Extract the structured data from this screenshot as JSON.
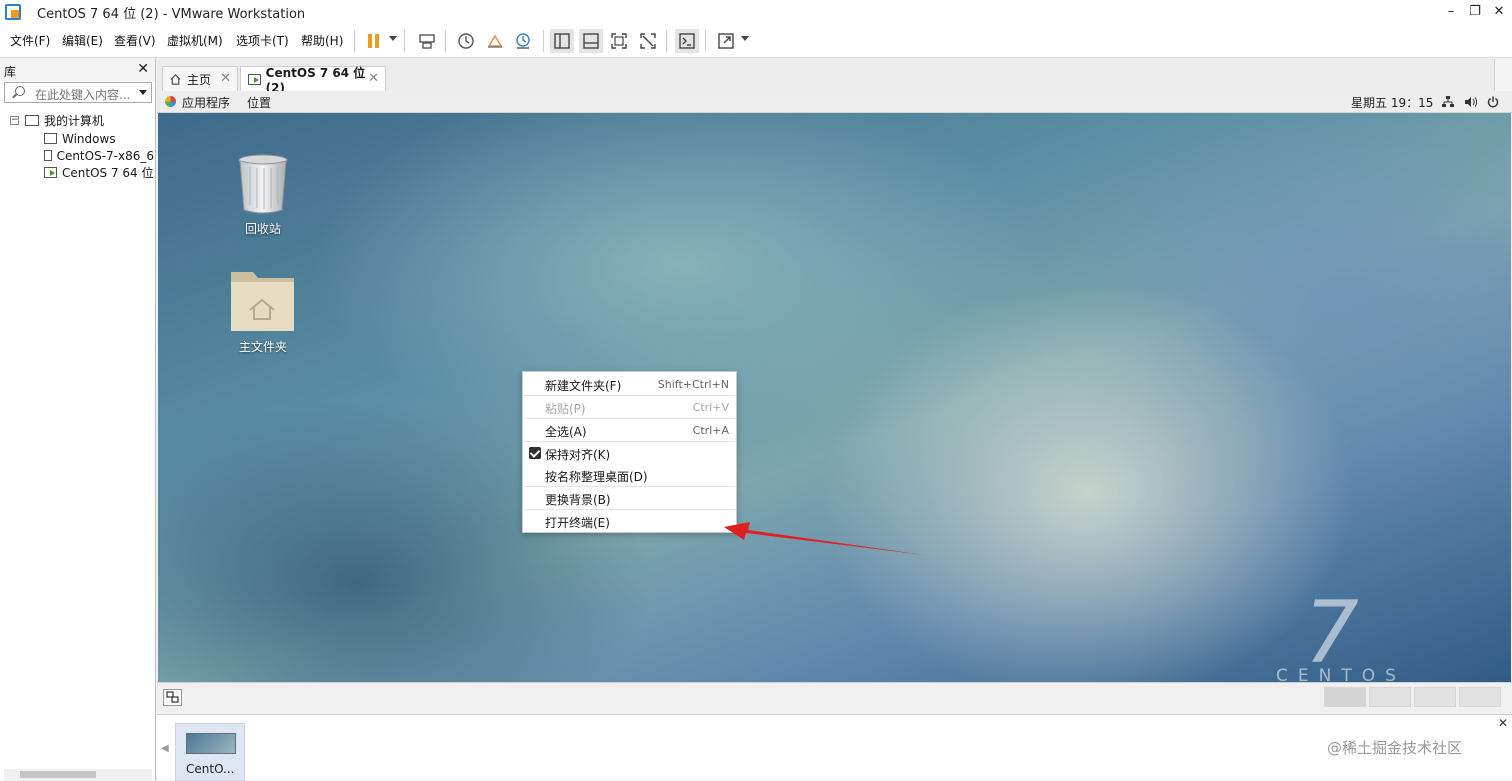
{
  "window": {
    "title": "CentOS 7 64 位 (2) - VMware Workstation",
    "min": "–",
    "max": "❐",
    "close": "✕"
  },
  "menu": [
    "文件(F)",
    "编辑(E)",
    "查看(V)",
    "虚拟机(M)",
    "选项卡(T)",
    "帮助(H)"
  ],
  "library": {
    "title": "库",
    "close": "✕",
    "search_placeholder": "在此处键入内容...",
    "tree": {
      "root": "我的计算机",
      "items": [
        "Windows",
        "CentOS-7-x86_6",
        "CentOS 7 64 位"
      ]
    }
  },
  "tabs": [
    {
      "label": "主页",
      "active": false
    },
    {
      "label": "CentOS 7 64 位 (2)",
      "active": true
    }
  ],
  "guest_panel": {
    "apps": "应用程序",
    "places": "位置",
    "clock": "星期五 19：15"
  },
  "desktop": {
    "icons": [
      {
        "label": "回收站",
        "icon": "trash-icon"
      },
      {
        "label": "主文件夹",
        "icon": "home-folder-icon"
      }
    ],
    "brand_number": "7",
    "brand_word": "CENTOS"
  },
  "context_menu": {
    "items": [
      {
        "label": "新建文件夹(F)",
        "shortcut": "Shift+Ctrl+N",
        "enabled": true,
        "checked": false
      },
      {
        "label": "粘贴(P)",
        "shortcut": "Ctrl+V",
        "enabled": false,
        "checked": false
      },
      {
        "label": "全选(A)",
        "shortcut": "Ctrl+A",
        "enabled": true,
        "checked": false
      },
      {
        "label": "保持对齐(K)",
        "shortcut": "",
        "enabled": true,
        "checked": true
      },
      {
        "label": "按名称整理桌面(D)",
        "shortcut": "",
        "enabled": true,
        "checked": false
      },
      {
        "label": "更换背景(B)",
        "shortcut": "",
        "enabled": true,
        "checked": false
      },
      {
        "label": "打开终端(E)",
        "shortcut": "",
        "enabled": true,
        "checked": false
      }
    ]
  },
  "thumbnail": {
    "label": "CentO...",
    "close": "✕",
    "scroll_left": "◀"
  },
  "watermark": "@稀土掘金技术社区",
  "colors": {
    "arrow": "#e02020",
    "accent": "#f29a1a"
  }
}
